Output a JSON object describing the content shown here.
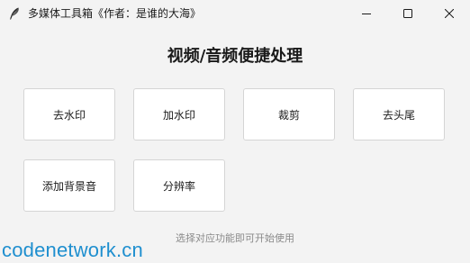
{
  "window": {
    "title": "多媒体工具箱《作者：是谁的大海》",
    "icon": "feather-icon",
    "controls": {
      "minimize_icon": "minimize-icon",
      "maximize_icon": "maximize-icon",
      "close_icon": "close-icon"
    }
  },
  "main": {
    "heading": "视频/音频便捷处理",
    "buttons": [
      {
        "label": "去水印"
      },
      {
        "label": "加水印"
      },
      {
        "label": "裁剪"
      },
      {
        "label": "去头尾"
      },
      {
        "label": "添加背景音"
      },
      {
        "label": "分辨率"
      }
    ],
    "hint": "选择对应功能即可开始使用"
  },
  "watermark": {
    "text": "codenetwork.cn",
    "color": "#1f8fcf"
  },
  "colors": {
    "background": "#f3f3f3",
    "button_bg": "#ffffff",
    "button_border": "#d5d5d5"
  }
}
